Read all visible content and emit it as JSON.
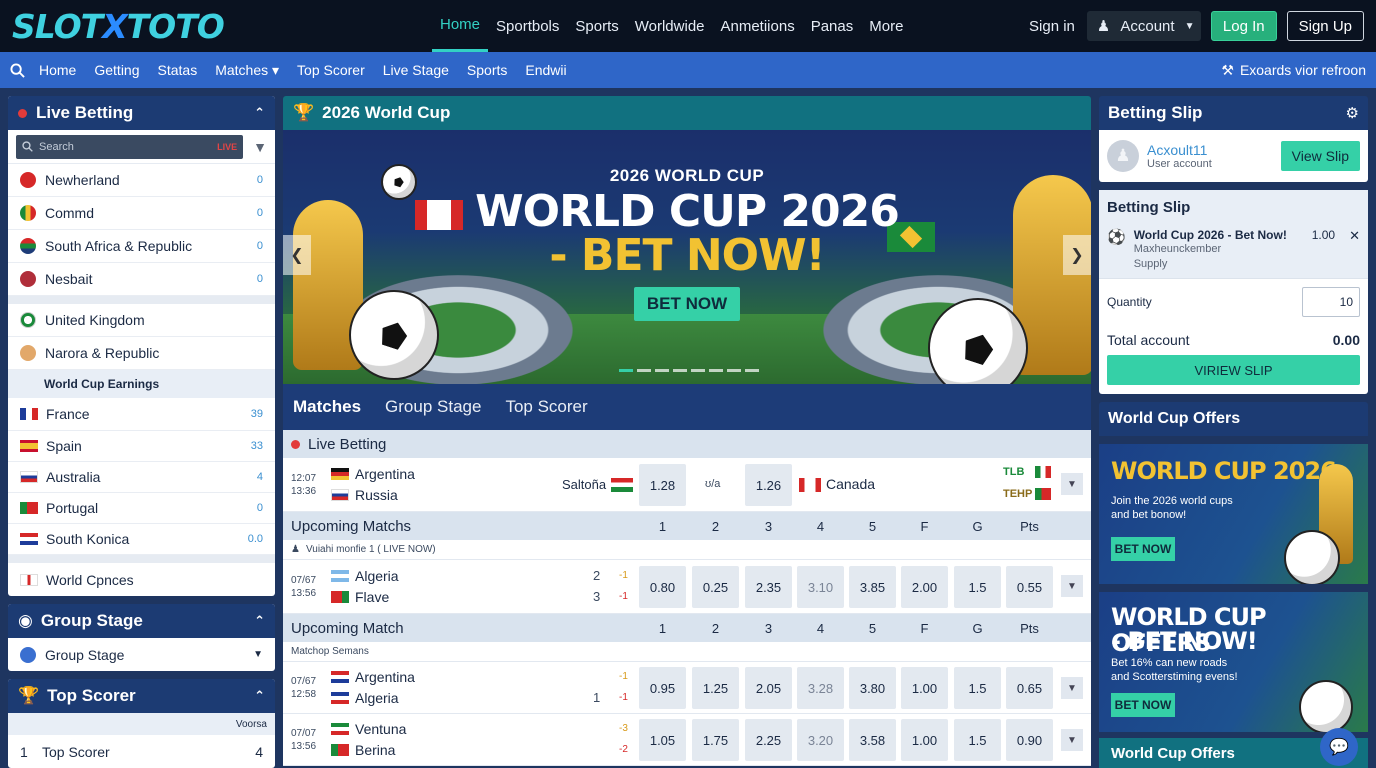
{
  "brand": {
    "logo_a": "SLOT",
    "logo_b": "X",
    "logo_c": "TOTO"
  },
  "topnav": {
    "items": [
      "Home",
      "Sportbols",
      "Sports",
      "Worldwide",
      "Anmetiions",
      "Panas",
      "More"
    ],
    "active": 0,
    "signin": "Sign in",
    "account": "Account",
    "login": "Log In",
    "signup": "Sign Up"
  },
  "subnav": {
    "items": [
      "Home",
      "Getting",
      "Statas",
      "Matches ▾",
      "Top Scorer",
      "Live Stage",
      "Sports",
      "Endwii"
    ],
    "right": "Exoards vior refroon"
  },
  "live_betting": {
    "title": "Live Betting",
    "search_placeholder": "Search",
    "live_tag": "LIVE",
    "items": [
      {
        "name": "Newherland",
        "count": "0"
      },
      {
        "name": "Commd",
        "count": "0"
      },
      {
        "name": "South Africa & Republic",
        "count": "0"
      },
      {
        "name": "Nesbait",
        "count": "0"
      }
    ],
    "items2": [
      {
        "name": "United Kingdom"
      },
      {
        "name": "Narora & Republic"
      }
    ],
    "sub_head": "World Cup Earnings",
    "countries": [
      {
        "name": "France",
        "count": "39"
      },
      {
        "name": "Spain",
        "count": "33"
      },
      {
        "name": "Australia",
        "count": "4"
      },
      {
        "name": "Portugal",
        "count": "0"
      },
      {
        "name": "South Konica",
        "count": "0.0"
      }
    ],
    "extra": "World Cpnces"
  },
  "group_stage": {
    "title": "Group Stage",
    "item": "Group Stage"
  },
  "top_scorer": {
    "title": "Top Scorer",
    "col": "Voorsa",
    "row_rank": "1",
    "row_name": "Top Scorer",
    "row_val": "4"
  },
  "center": {
    "title": "2026 World Cup",
    "banner": {
      "sub": "2026 WORLD CUP",
      "line1": "WORLD CUP 2026",
      "line2": "- BET NOW!",
      "cta": "BET NOW"
    },
    "tabs": [
      "Matches",
      "Group Stage",
      "Top Scorer"
    ],
    "live_head": "Live Betting",
    "live_match": {
      "time1": "12:07",
      "time2": "13:36",
      "team1": "Argentina",
      "team2": "Russia",
      "mid": "Saltoña",
      "odd1": "1.28",
      "vs": "ʊ/a",
      "odd2": "1.26",
      "opp": "Canada",
      "tag1": "TLB",
      "tag2": "TEHP"
    },
    "cols": [
      "1",
      "2",
      "3",
      "4",
      "5",
      "F",
      "G",
      "Pts"
    ],
    "upcoming1": {
      "head": "Upcoming Matchs",
      "note": "Vuiahi monfie 1 ( LIVE NOW)",
      "match": {
        "time1": "07/67",
        "time2": "13:56",
        "team1": "Algeria",
        "team2": "Flave",
        "s1": "2",
        "s2": "3",
        "d1": "-1",
        "d2": "-1",
        "odds": [
          "0.80",
          "0.25",
          "2.35",
          "3.10",
          "3.85",
          "2.00",
          "1.5",
          "0.55"
        ]
      }
    },
    "upcoming2": {
      "head": "Upcoming Match",
      "note": "Matchop Semans",
      "matches": [
        {
          "time1": "07/67",
          "time2": "12:58",
          "team1": "Argentina",
          "team2": "Algeria",
          "s1": "",
          "s2": "1",
          "d1": "-1",
          "d2": "-1",
          "odds": [
            "0.95",
            "1.25",
            "2.05",
            "3.28",
            "3.80",
            "1.00",
            "1.5",
            "0.65"
          ]
        },
        {
          "time1": "07/07",
          "time2": "13:56",
          "team1": "Ventuna",
          "team2": "Berina",
          "s1": "",
          "s2": "",
          "d1": "-3",
          "d2": "-2",
          "odds": [
            "1.05",
            "1.75",
            "2.25",
            "3.20",
            "3.58",
            "1.00",
            "1.5",
            "0.90"
          ]
        }
      ]
    }
  },
  "right": {
    "slip_title": "Betting Slip",
    "user": "Acxoult11",
    "user_sub": "User account",
    "view_slip": "View Slip",
    "slip_inner": "Betting Slip",
    "bet": {
      "title": "World Cup 2026 - Bet Now!",
      "odd": "1.00",
      "line2": "Maxheunckember",
      "line3": "Supply"
    },
    "quantity_label": "Quantity",
    "quantity_value": "10",
    "total_label": "Total account",
    "total_value": "0.00",
    "view_btn": "VIRIEW SLIP",
    "offers_title": "World Cup Offers",
    "offer1": {
      "title": "WORLD CUP 2026",
      "desc1": "Join the 2026 world cups",
      "desc2": "and bet bonow!",
      "btn": "BET NOW"
    },
    "offer2": {
      "title1": "WORLD CUP OFFERS",
      "title2": "- BET NOW!",
      "desc1": "Bet 16% can new roads",
      "desc2": "and Scotterstiming evens!",
      "btn": "BET NOW"
    },
    "footer": "World Cup Offers"
  }
}
